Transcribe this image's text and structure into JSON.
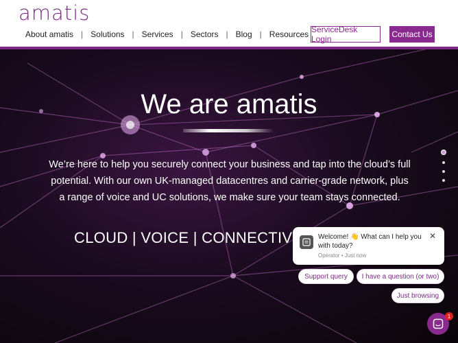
{
  "brand": {
    "logo": "amatis",
    "accent": "#8a2a8f"
  },
  "nav": {
    "items": [
      "About amatis",
      "Solutions",
      "Services",
      "Sectors",
      "Blog",
      "Resources"
    ],
    "separator": "|"
  },
  "header_buttons": {
    "servicedesk": "ServiceDesk Login",
    "contact": "Contact Us"
  },
  "hero": {
    "title": "We are amatis",
    "text": "We’re here to help you securely connect your business and tap into the cloud’s full potential. With our own UK-managed datacentres and carrier-grade network, plus a range of voice and UC solutions, we make sure your team stays connected.",
    "tagline": "CLOUD | VOICE | CONNECTIVITY",
    "slides": {
      "count": 4,
      "active": 1
    }
  },
  "chat": {
    "message": "Welcome! 👋 What can I help you with today?",
    "meta": "Operator • Just now",
    "quick_replies": [
      "Support query",
      "I have a question (or two)",
      "Just browsing"
    ],
    "unread_count": "1"
  }
}
